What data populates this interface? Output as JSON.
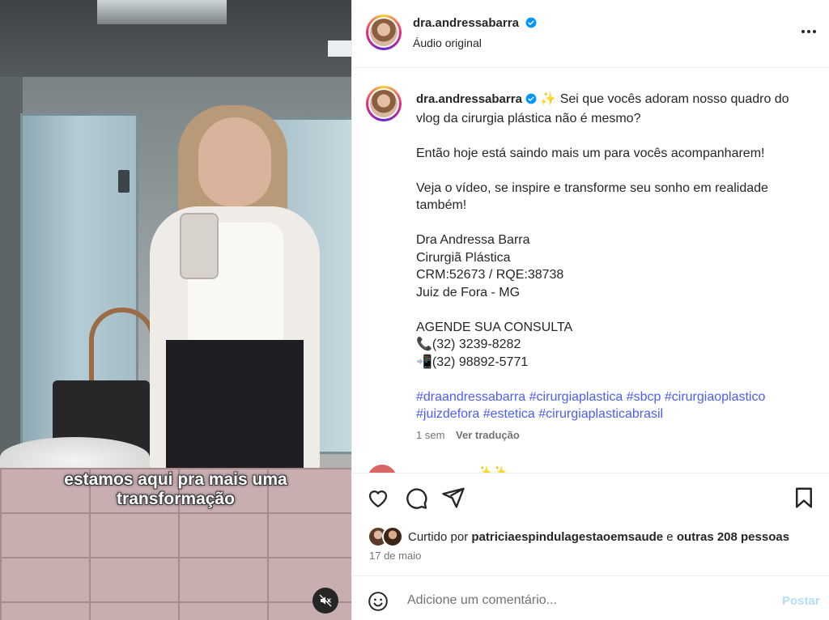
{
  "video": {
    "caption_line1": "estamos aqui pra mais uma",
    "caption_line2": "transformação",
    "mute_icon": "speaker-muted-icon"
  },
  "header": {
    "username": "dra.andressabarra",
    "subtitle": "Áudio original",
    "more_icon": "more-options-icon"
  },
  "post": {
    "username": "dra.andressabarra",
    "lines": [
      "✨ Sei que vocês adoram nosso quadro do vlog da cirurgia plástica não é mesmo?",
      "Então hoje está saindo mais um para vocês acompanharem!",
      "Veja o vídeo, se inspire e transforme seu sonho em realidade também!",
      "Dra Andressa Barra",
      "Cirurgiã Plástica",
      "CRM:52673 / RQE:38738",
      "Juiz de Fora - MG",
      "AGENDE SUA CONSULTA",
      "📞(32) 3239-8282",
      "📲(32) 98892-5771"
    ],
    "hashtags": [
      "#draandressabarra",
      "#cirurgiaplastica",
      "#sbcp",
      "#cirurgiaoplastico",
      "#juizdefora",
      "#estetica",
      "#cirurgiaplasticabrasil"
    ],
    "age": "1 sem",
    "translate": "Ver tradução"
  },
  "comment_peek": "_ _ _ _ _ _ ✨✨",
  "actions": {
    "like_icon": "heart-icon",
    "comment_icon": "comment-icon",
    "share_icon": "share-icon",
    "save_icon": "bookmark-icon"
  },
  "likes": {
    "prefix": "Curtido por",
    "user": "patriciaespindulagestaoemsaude",
    "and": "e",
    "others": "outras 208 pessoas"
  },
  "date": "17 de maio",
  "comment_box": {
    "emoji_icon": "emoji-icon",
    "placeholder": "Adicione um comentário...",
    "post_label": "Postar",
    "post_color": "#b2dffc"
  },
  "colors": {
    "hashtag": "#4a5df9",
    "verified": "#0095f6",
    "muted_text": "#737373"
  }
}
